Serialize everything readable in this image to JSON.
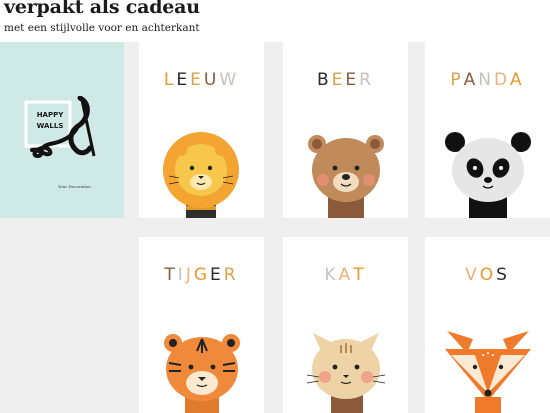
{
  "header": {
    "title": "verpakt als cadeau",
    "subtitle": "met een stijlvolle voor en achterkant"
  },
  "brand_card": {
    "line1": "HAPPY",
    "line2": "WALLS",
    "signature": "Your Decoration"
  },
  "cards": [
    {
      "label": "LEEUW",
      "animal": "lion-icon"
    },
    {
      "label": "BEER",
      "animal": "bear-icon"
    },
    {
      "label": "PANDA",
      "animal": "panda-icon"
    },
    {
      "label": "TIJGER",
      "animal": "tiger-icon"
    },
    {
      "label": "KAT",
      "animal": "cat-icon"
    },
    {
      "label": "VOS",
      "animal": "fox-icon"
    }
  ],
  "colors": {
    "letter_palette": [
      "#e79a2c",
      "#2a2a2a",
      "#d7a24a",
      "#8a5a3a",
      "#c7c2bb",
      "#f0b07a"
    ],
    "brand_bg": "#cfe9e7",
    "page_bg": "#efefef"
  }
}
